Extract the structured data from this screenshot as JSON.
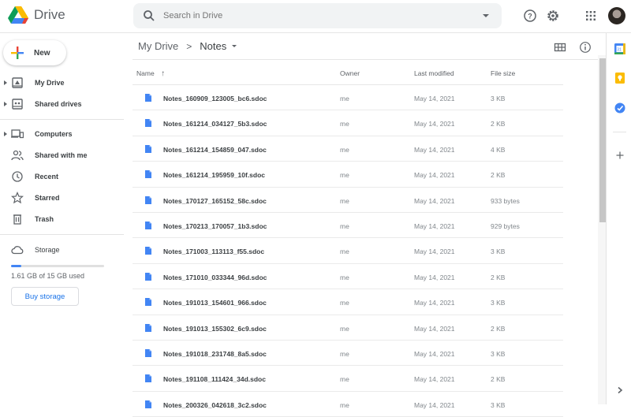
{
  "header": {
    "app_name": "Drive",
    "search_placeholder": "Search in Drive",
    "icons": [
      "drive-logo",
      "search-icon",
      "search-options-icon",
      "help-icon",
      "settings-icon",
      "apps-grid-icon",
      "account-avatar"
    ]
  },
  "sidebar": {
    "new_label": "New",
    "items": [
      {
        "label": "My Drive",
        "icon": "my-drive-icon",
        "expandable": true
      },
      {
        "label": "Shared drives",
        "icon": "shared-drives-icon",
        "expandable": true
      },
      {
        "label": "Computers",
        "icon": "computers-icon",
        "expandable": true
      },
      {
        "label": "Shared with me",
        "icon": "shared-with-me-icon",
        "expandable": false
      },
      {
        "label": "Recent",
        "icon": "clock-icon",
        "expandable": false
      },
      {
        "label": "Starred",
        "icon": "star-icon",
        "expandable": false
      },
      {
        "label": "Trash",
        "icon": "trash-icon",
        "expandable": false
      }
    ],
    "storage": {
      "label": "Storage",
      "used_text": "1.61 GB of 15 GB used",
      "used_fraction": 0.107,
      "buy_label": "Buy storage"
    }
  },
  "main": {
    "breadcrumb": [
      {
        "label": "My Drive"
      },
      {
        "label": "Notes",
        "current": true
      }
    ],
    "breadcrumb_separator": ">",
    "columns": {
      "name": "Name",
      "sort_indicator": "↑",
      "owner": "Owner",
      "modified": "Last modified",
      "size": "File size"
    },
    "files": [
      {
        "name": "Notes_160909_123005_bc6.sdoc",
        "owner": "me",
        "modified": "May 14, 2021",
        "size": "3 KB"
      },
      {
        "name": "Notes_161214_034127_5b3.sdoc",
        "owner": "me",
        "modified": "May 14, 2021",
        "size": "2 KB"
      },
      {
        "name": "Notes_161214_154859_047.sdoc",
        "owner": "me",
        "modified": "May 14, 2021",
        "size": "4 KB"
      },
      {
        "name": "Notes_161214_195959_10f.sdoc",
        "owner": "me",
        "modified": "May 14, 2021",
        "size": "2 KB"
      },
      {
        "name": "Notes_170127_165152_58c.sdoc",
        "owner": "me",
        "modified": "May 14, 2021",
        "size": "933 bytes"
      },
      {
        "name": "Notes_170213_170057_1b3.sdoc",
        "owner": "me",
        "modified": "May 14, 2021",
        "size": "929 bytes"
      },
      {
        "name": "Notes_171003_113113_f55.sdoc",
        "owner": "me",
        "modified": "May 14, 2021",
        "size": "3 KB"
      },
      {
        "name": "Notes_171010_033344_96d.sdoc",
        "owner": "me",
        "modified": "May 14, 2021",
        "size": "2 KB"
      },
      {
        "name": "Notes_191013_154601_966.sdoc",
        "owner": "me",
        "modified": "May 14, 2021",
        "size": "3 KB"
      },
      {
        "name": "Notes_191013_155302_6c9.sdoc",
        "owner": "me",
        "modified": "May 14, 2021",
        "size": "2 KB"
      },
      {
        "name": "Notes_191018_231748_8a5.sdoc",
        "owner": "me",
        "modified": "May 14, 2021",
        "size": "3 KB"
      },
      {
        "name": "Notes_191108_111424_34d.sdoc",
        "owner": "me",
        "modified": "May 14, 2021",
        "size": "2 KB"
      },
      {
        "name": "Notes_200326_042618_3c2.sdoc",
        "owner": "me",
        "modified": "May 14, 2021",
        "size": "3 KB"
      }
    ]
  },
  "rightbar": {
    "apps": [
      "calendar-icon",
      "keep-icon",
      "tasks-icon",
      "add-addon-icon"
    ],
    "expand_icon": "chevron-right-icon"
  },
  "colors": {
    "accent": "#1a73e8",
    "file_icon": "#4285f4",
    "storage_fill": "#4285f4"
  }
}
